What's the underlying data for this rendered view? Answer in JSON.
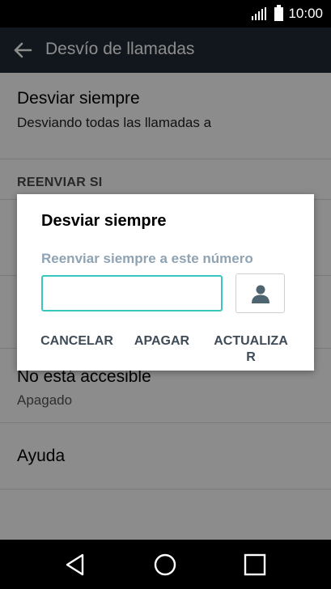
{
  "status_bar": {
    "time": "10:00"
  },
  "action_bar": {
    "title": "Desvío de llamadas"
  },
  "list": {
    "item1": {
      "title": "Desviar siempre",
      "subtitle": "Desviando todas las llamadas a"
    },
    "section_header": "REENVIAR SI",
    "item_unreachable": {
      "title": "No está accesible",
      "subtitle": "Apagado"
    },
    "item_help": {
      "title": "Ayuda"
    }
  },
  "dialog": {
    "title": "Desviar siempre",
    "label": "Reenviar siempre a este número",
    "input_value": "",
    "buttons": {
      "cancel": "CANCELAR",
      "off": "APAGAR",
      "update_line1": "ACTUALIZA",
      "update_line2": "R"
    }
  },
  "colors": {
    "accent": "#39c6c0",
    "action_bar": "#212b36",
    "label": "#8fa3b4"
  }
}
